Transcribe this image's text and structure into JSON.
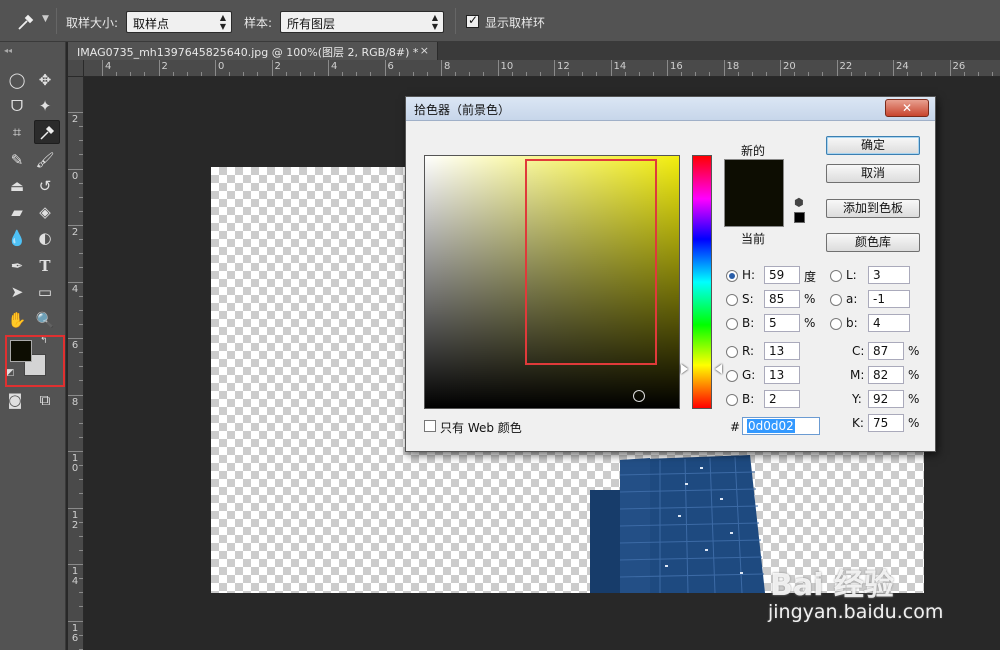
{
  "options_bar": {
    "tool_icon": "eyedropper-icon",
    "sample_size_label": "取样大小:",
    "sample_size_value": "取样点",
    "sample_label": "样本:",
    "sample_value": "所有图层",
    "show_ring_label": "显示取样环",
    "show_ring_checked": true
  },
  "document_tab": {
    "title": "IMAG0735_mh1397645825640.jpg @ 100%(图层 2, RGB/8#) *",
    "close": "×"
  },
  "ruler_top": [
    "4",
    "2",
    "0",
    "2",
    "4",
    "6",
    "8",
    "10",
    "12",
    "14",
    "16",
    "18",
    "20",
    "22",
    "24",
    "26"
  ],
  "ruler_left": [
    "2",
    "0",
    "2",
    "4",
    "6",
    "8",
    "10",
    "12",
    "14",
    "16"
  ],
  "toolbar": {
    "tools": [
      "marquee-icon",
      "move-icon",
      "lasso-icon",
      "magic-wand-icon",
      "crop-icon",
      "eyedropper-icon",
      "healing-brush-icon",
      "brush-icon",
      "stamp-icon",
      "history-brush-icon",
      "eraser-icon",
      "paint-bucket-icon",
      "blur-icon",
      "dodge-icon",
      "pen-icon",
      "type-icon",
      "path-select-icon",
      "rectangle-icon",
      "hand-icon",
      "zoom-icon",
      "quick-mask-icon",
      "screen-mode-icon"
    ],
    "type_tool_label": "T",
    "foreground_color": "#0d0d02",
    "background_color": "#d4d4d4"
  },
  "color_picker": {
    "title": "拾色器（前景色）",
    "new_label": "新的",
    "current_label": "当前",
    "ok": "确定",
    "cancel": "取消",
    "add_to_swatches": "添加到色板",
    "color_libraries": "颜色库",
    "h_label": "H:",
    "h_value": "59",
    "h_unit": "度",
    "s_label": "S:",
    "s_value": "85",
    "s_unit": "%",
    "b_label": "B:",
    "b_value": "5",
    "b_unit": "%",
    "r_label": "R:",
    "r_value": "13",
    "g_label": "G:",
    "g_value": "13",
    "bb_label": "B:",
    "bb_value": "2",
    "l_label": "L:",
    "l_value": "3",
    "a_label": "a:",
    "a_value": "-1",
    "blab_label": "b:",
    "blab_value": "4",
    "c_label": "C:",
    "c_value": "87",
    "c_unit": "%",
    "m_label": "M:",
    "m_value": "82",
    "m_unit": "%",
    "y_label": "Y:",
    "y_value": "92",
    "y_unit": "%",
    "k_label": "K:",
    "k_value": "75",
    "k_unit": "%",
    "hex_label": "#",
    "hex_value": "0d0d02",
    "web_only_label": "只有 Web 颜色",
    "selected_hue": "#f3ee0e",
    "new_color": "#0d0d02"
  },
  "watermark": {
    "logo": "Bai 经验",
    "url": "jingyan.baidu.com"
  }
}
